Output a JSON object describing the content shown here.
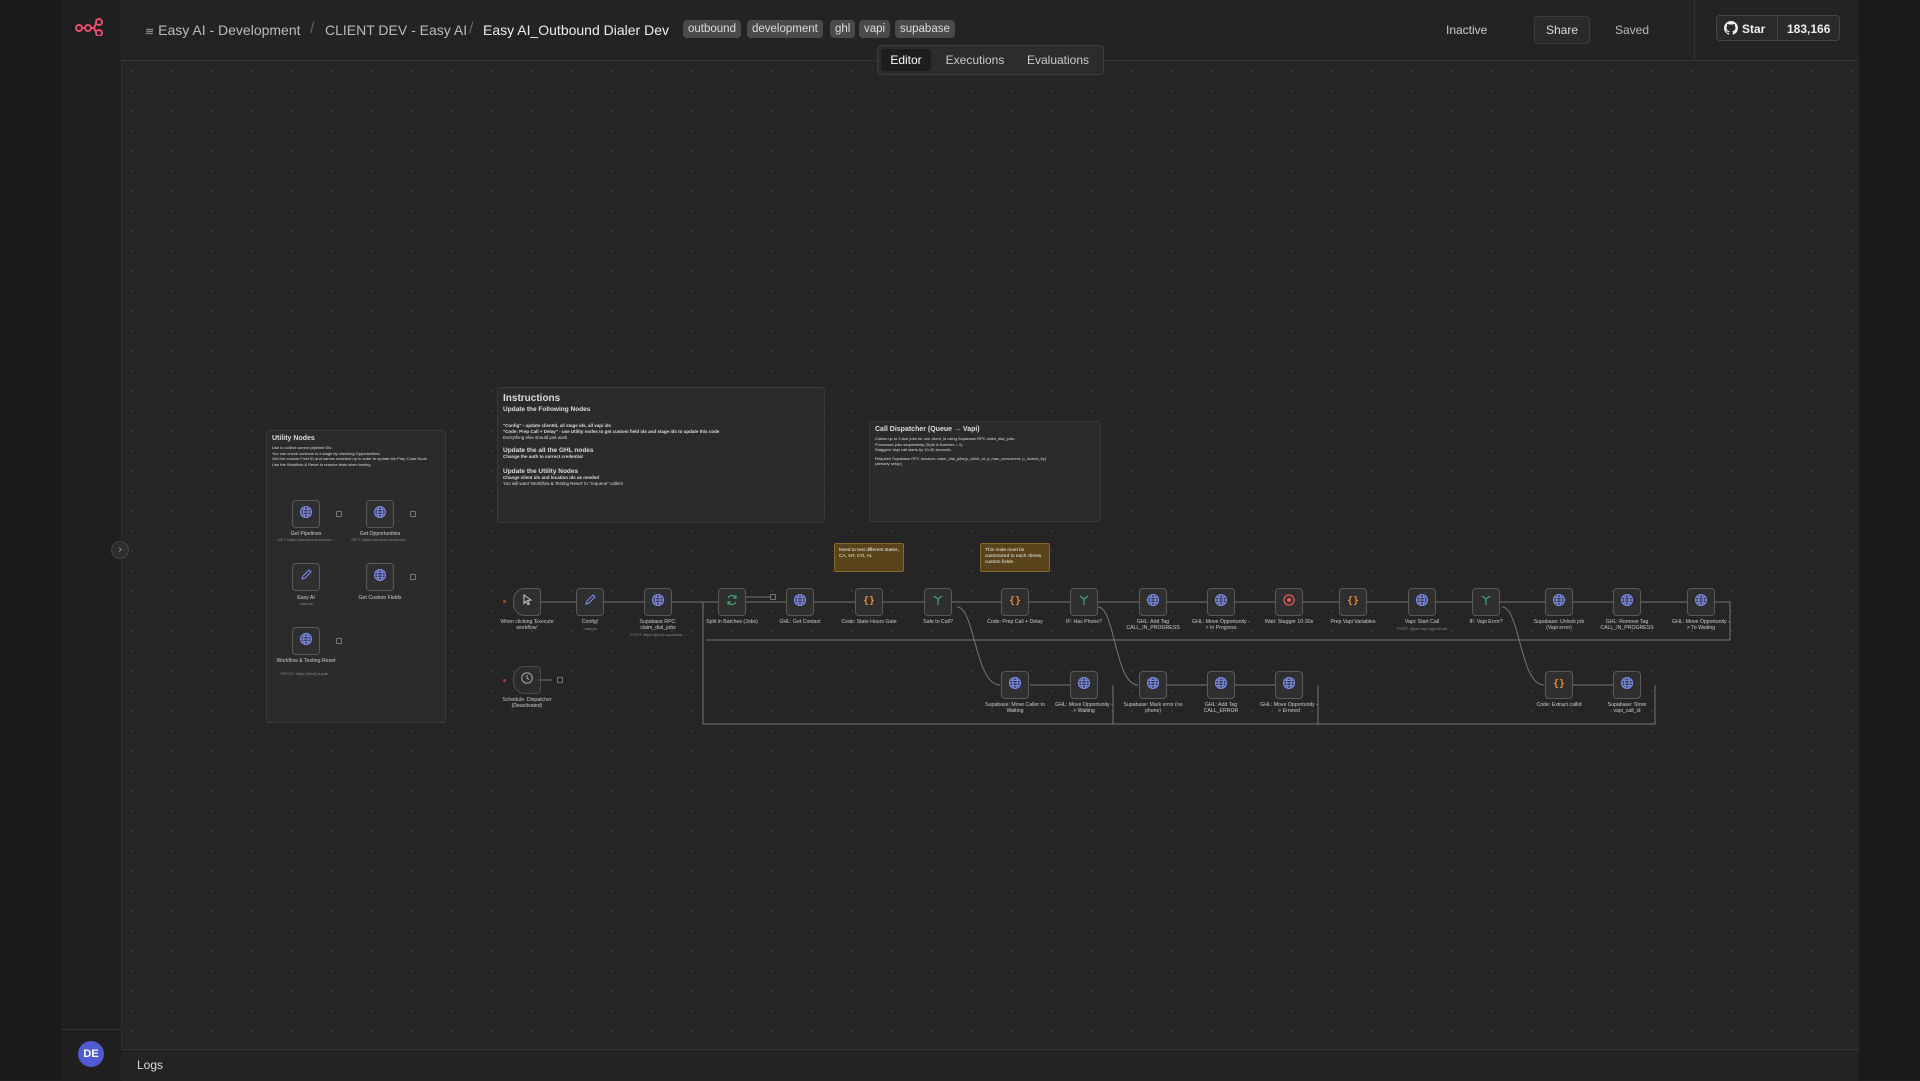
{
  "breadcrumb": {
    "project": "Easy AI - Development",
    "folder": "CLIENT DEV - Easy AI",
    "workflow": "Easy AI_Outbound Dialer Dev"
  },
  "tags": [
    "outbound",
    "development",
    "ghl",
    "vapi",
    "supabase"
  ],
  "status": "Inactive",
  "share_label": "Share",
  "saved_label": "Saved",
  "github": {
    "star_label": "Star",
    "count": "183,166"
  },
  "tabs": [
    {
      "label": "Editor",
      "active": true
    },
    {
      "label": "Executions",
      "active": false
    },
    {
      "label": "Evaluations",
      "active": false
    }
  ],
  "user_initials": "DE",
  "logs_label": "Logs",
  "colors": {
    "accent": "#ea4b71",
    "node_http": "#7b8cf0",
    "node_code": "#e8912d",
    "node_if": "#3fa66b",
    "node_wait": "#ef5a5a"
  },
  "notes": {
    "utility": {
      "title": "Utility Nodes",
      "lines": [
        "Use to collect correct pipeline IDs.",
        "You can check contacts in a stage by checking Opportunities.",
        "Get the custom Field ID and names matched up in order to update the Prep Code Node",
        "Use the Workflow & Reset to remove tests when testing"
      ]
    },
    "instructions": {
      "title": "Instructions",
      "h1": "Update the Following Nodes",
      "p1": "\"Config\" - update clientId, all stage ids, all vapi ids",
      "p2": "\"Code: Prep Call + Delay\" - use Utility nodes to get custom field ids and stage ids to update this code",
      "p3": "Everything else should just work",
      "h2": "Update the all the GHL nodes",
      "p4": "Change the auth to correct credential",
      "h3": "Update the Utility Nodes",
      "p5": "Change client ids and location ids as needed",
      "p6": "You will want 'Workflow & Testing Reset' to \"requeue\" callers"
    },
    "dispatcher": {
      "title": "Call Dispatcher (Queue → Vapi)",
      "lines": [
        "Claims up to 3 due jobs for one client_id using Supabase RPC claim_dial_jobs.",
        "Processes jobs sequentially (Split in Batches = 1).",
        "Staggers Vapi call starts by 10-45 seconds."
      ],
      "req": "Requires Supabase RPC function: claim_dial_jobs(p_client_id, p_max_concurrent, p_locked_by)",
      "req2": "(already setup)"
    },
    "states": "Need to test different states, CA, NY, CO, AL",
    "custom": "This node must be customized to each clients custom fields"
  },
  "utility_nodes": [
    {
      "label": "Get Pipelines",
      "sub": "GET: https://services.leadconn...",
      "icon": "globe-icon"
    },
    {
      "label": "Get Opportunities",
      "sub": "GET: https://services.leadconn...",
      "icon": "globe-icon"
    },
    {
      "label": "Easy AI",
      "sub": "manual",
      "icon": "pencil-icon"
    },
    {
      "label": "Get Custom Fields",
      "sub": "",
      "icon": "globe-icon"
    },
    {
      "label": "Workflow & Testing Reset",
      "sub": "PATCH: https://[text].supab...",
      "icon": "globe-icon"
    }
  ],
  "main_nodes": [
    {
      "label": "When clicking 'Execute workflow'",
      "sub": "",
      "icon": "cursor-icon"
    },
    {
      "label": "Config!",
      "sub": "manual",
      "icon": "pencil-icon"
    },
    {
      "label": "Supabase RPC: claim_dial_jobs",
      "sub": "POST: https://[text].supabase...",
      "icon": "globe-icon"
    },
    {
      "label": "Split in Batches (Jobs)",
      "sub": "",
      "icon": "loop-icon"
    },
    {
      "label": "GHL: Get Contact",
      "sub": "",
      "icon": "globe-icon"
    },
    {
      "label": "Code: State Hours Gate",
      "sub": "",
      "icon": "code-icon"
    },
    {
      "label": "Safe to Call?",
      "sub": "",
      "icon": "if-icon"
    },
    {
      "label": "Code: Prep Call + Delay",
      "sub": "",
      "icon": "code-icon"
    },
    {
      "label": "IF: Has Phone?",
      "sub": "",
      "icon": "if-icon"
    },
    {
      "label": "GHL: Add Tag CALL_IN_PROGRESS",
      "sub": "",
      "icon": "globe-icon"
    },
    {
      "label": "GHL: Move Opportunity -> In Progress",
      "sub": "",
      "icon": "globe-icon"
    },
    {
      "label": "Wait: Stagger 10-30s",
      "sub": "",
      "icon": "wait-icon"
    },
    {
      "label": "Prep Vapi Variables",
      "sub": "",
      "icon": "code-icon"
    },
    {
      "label": "Vapi: Start Call",
      "sub": "POST: https://api.vapi.ai/call",
      "icon": "globe-icon"
    },
    {
      "label": "IF: Vapi Error?",
      "sub": "",
      "icon": "if-icon"
    },
    {
      "label": "Supabase: Unlock job (Vapi error)",
      "sub": "",
      "icon": "globe-icon"
    },
    {
      "label": "GHL: Remove Tag CALL_IN_PROGRESS",
      "sub": "",
      "icon": "globe-icon"
    },
    {
      "label": "GHL: Move Opportunity -> To Waiting",
      "sub": "",
      "icon": "globe-icon"
    }
  ],
  "lower_nodes": [
    {
      "label": "Supabase: Move Caller to Waiting",
      "sub": "",
      "icon": "globe-icon"
    },
    {
      "label": "GHL: Move Opportunity -> Waiting",
      "sub": "",
      "icon": "globe-icon"
    },
    {
      "label": "Supabase: Mark error (no phone)",
      "sub": "",
      "icon": "globe-icon"
    },
    {
      "label": "GHL: Add Tag CALL_ERROR",
      "sub": "",
      "icon": "globe-icon"
    },
    {
      "label": "GHL: Move Opportunity -> Errored",
      "sub": "",
      "icon": "globe-icon"
    },
    {
      "label": "Code: Extract callId",
      "sub": "",
      "icon": "code-icon"
    },
    {
      "label": "Supabase: Store vapi_call_id",
      "sub": "",
      "icon": "globe-icon"
    }
  ],
  "schedule_node": {
    "label": "Schedule: Dispatcher (Deactivated)",
    "icon": "clock-icon"
  }
}
